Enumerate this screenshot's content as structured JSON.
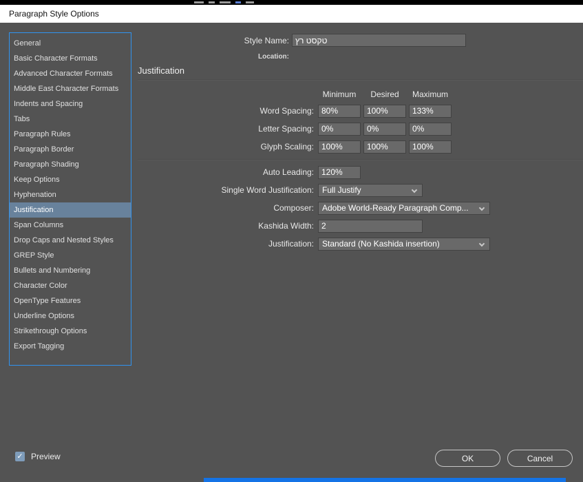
{
  "window": {
    "title": "Paragraph Style Options"
  },
  "style_name": {
    "label": "Style Name:",
    "value": "טקסט רץ"
  },
  "location_label": "Location:",
  "section_title": "Justification",
  "table": {
    "columns": [
      "Minimum",
      "Desired",
      "Maximum"
    ],
    "rows": [
      {
        "label": "Word Spacing:",
        "values": [
          "80%",
          "100%",
          "133%"
        ]
      },
      {
        "label": "Letter Spacing:",
        "values": [
          "0%",
          "0%",
          "0%"
        ]
      },
      {
        "label": "Glyph Scaling:",
        "values": [
          "100%",
          "100%",
          "100%"
        ]
      }
    ]
  },
  "fields": [
    {
      "key": "auto-leading",
      "label": "Auto Leading:",
      "value": "120%",
      "type": "input"
    },
    {
      "key": "single-word-justification",
      "label": "Single Word Justification:",
      "value": "Full Justify",
      "type": "select"
    },
    {
      "key": "composer",
      "label": "Composer:",
      "value": "Adobe World-Ready Paragraph Comp...",
      "type": "select"
    },
    {
      "key": "kashida-width",
      "label": "Kashida Width:",
      "value": "2",
      "type": "input"
    },
    {
      "key": "justification",
      "label": "Justification:",
      "value": "Standard (No Kashida insertion)",
      "type": "select"
    }
  ],
  "sidebar": {
    "selected": "Justification",
    "items": [
      "General",
      "Basic Character Formats",
      "Advanced Character Formats",
      "Middle East Character Formats",
      "Indents and Spacing",
      "Tabs",
      "Paragraph Rules",
      "Paragraph Border",
      "Paragraph Shading",
      "Keep Options",
      "Hyphenation",
      "Justification",
      "Span Columns",
      "Drop Caps and Nested Styles",
      "GREP Style",
      "Bullets and Numbering",
      "Character Color",
      "OpenType Features",
      "Underline Options",
      "Strikethrough Options",
      "Export Tagging"
    ]
  },
  "footer": {
    "preview_label": "Preview",
    "preview_checked": true,
    "ok_label": "OK",
    "cancel_label": "Cancel"
  },
  "colors": {
    "dialog_bg": "#535353",
    "titlebar_bg": "#ffffff",
    "sidebar_border_blue": "#3094f1",
    "selected_item_bg": "#68829c",
    "field_bg": "#696969",
    "bottom_strip_blue": "#1473e6"
  }
}
